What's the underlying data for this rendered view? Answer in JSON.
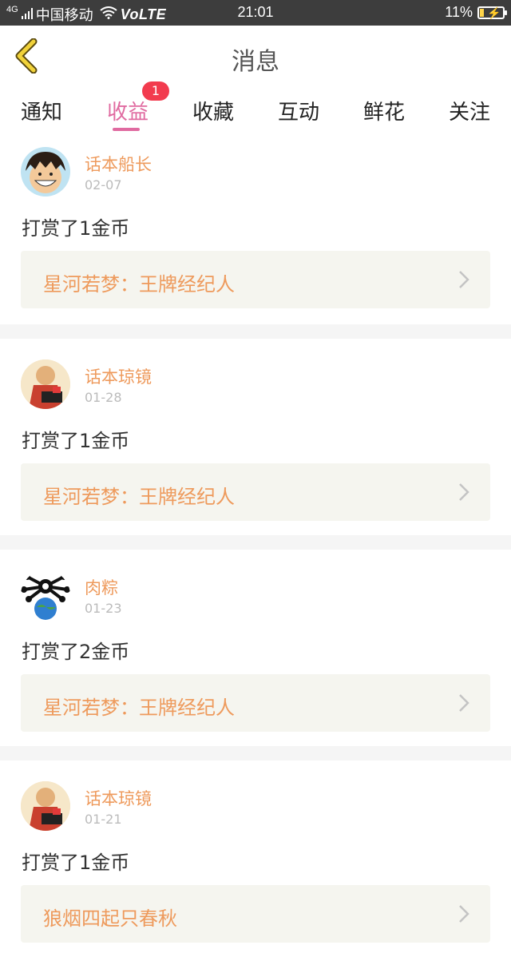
{
  "status": {
    "network": "4G",
    "carrier": "中国移动",
    "volte": "VoLTE",
    "time": "21:01",
    "battery": "11%"
  },
  "header": {
    "title": "消息",
    "back_icon": "chevron-left-icon"
  },
  "tabs": [
    {
      "label": "通知"
    },
    {
      "label": "收益",
      "active": true,
      "badge": "1"
    },
    {
      "label": "收藏"
    },
    {
      "label": "互动"
    },
    {
      "label": "鲜花"
    },
    {
      "label": "关注"
    }
  ],
  "colors": {
    "accent": "#e06aa0",
    "username": "#ee9a5c",
    "badge": "#f23b4e",
    "link_bg": "#f5f5ef"
  },
  "messages": [
    {
      "user": "话本船长",
      "date": "02-07",
      "action": "打赏了1金币",
      "book": "星河若梦：王牌经纪人"
    },
    {
      "user": "话本琼镜",
      "date": "01-28",
      "action": "打赏了1金币",
      "book": "星河若梦：王牌经纪人"
    },
    {
      "user": "肉粽",
      "date": "01-23",
      "action": "打赏了2金币",
      "book": "星河若梦：王牌经纪人"
    },
    {
      "user": "话本琼镜",
      "date": "01-21",
      "action": "打赏了1金币",
      "book": "狼烟四起只春秋"
    }
  ]
}
